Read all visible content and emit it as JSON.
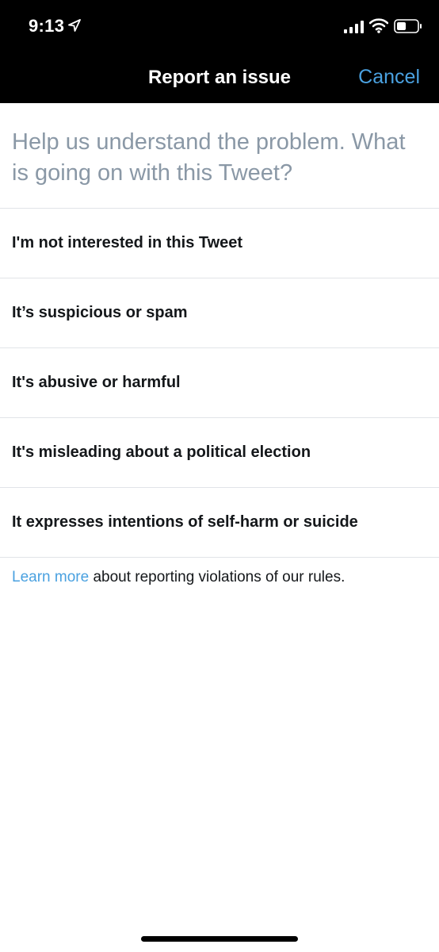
{
  "status_bar": {
    "time": "9:13"
  },
  "nav": {
    "title": "Report an issue",
    "cancel_label": "Cancel"
  },
  "prompt": "Help us understand the problem. What is going on with this Tweet?",
  "options": [
    {
      "label": "I'm not interested in this Tweet"
    },
    {
      "label": "It’s suspicious or spam"
    },
    {
      "label": "It's abusive or harmful"
    },
    {
      "label": "It's misleading about a political election"
    },
    {
      "label": "It expresses intentions of self-harm or suicide"
    }
  ],
  "footer": {
    "link_label": "Learn more",
    "text": " about reporting violations of our rules."
  },
  "colors": {
    "accent": "#4aa1e0",
    "prompt_text": "#8a98a6",
    "primary_text": "#14171a",
    "divider": "#e1e4e8",
    "bar_background": "#000000"
  },
  "icons": {
    "location": "location-arrow-icon",
    "signal": "cellular-signal-icon",
    "wifi": "wifi-icon",
    "battery": "battery-icon"
  }
}
